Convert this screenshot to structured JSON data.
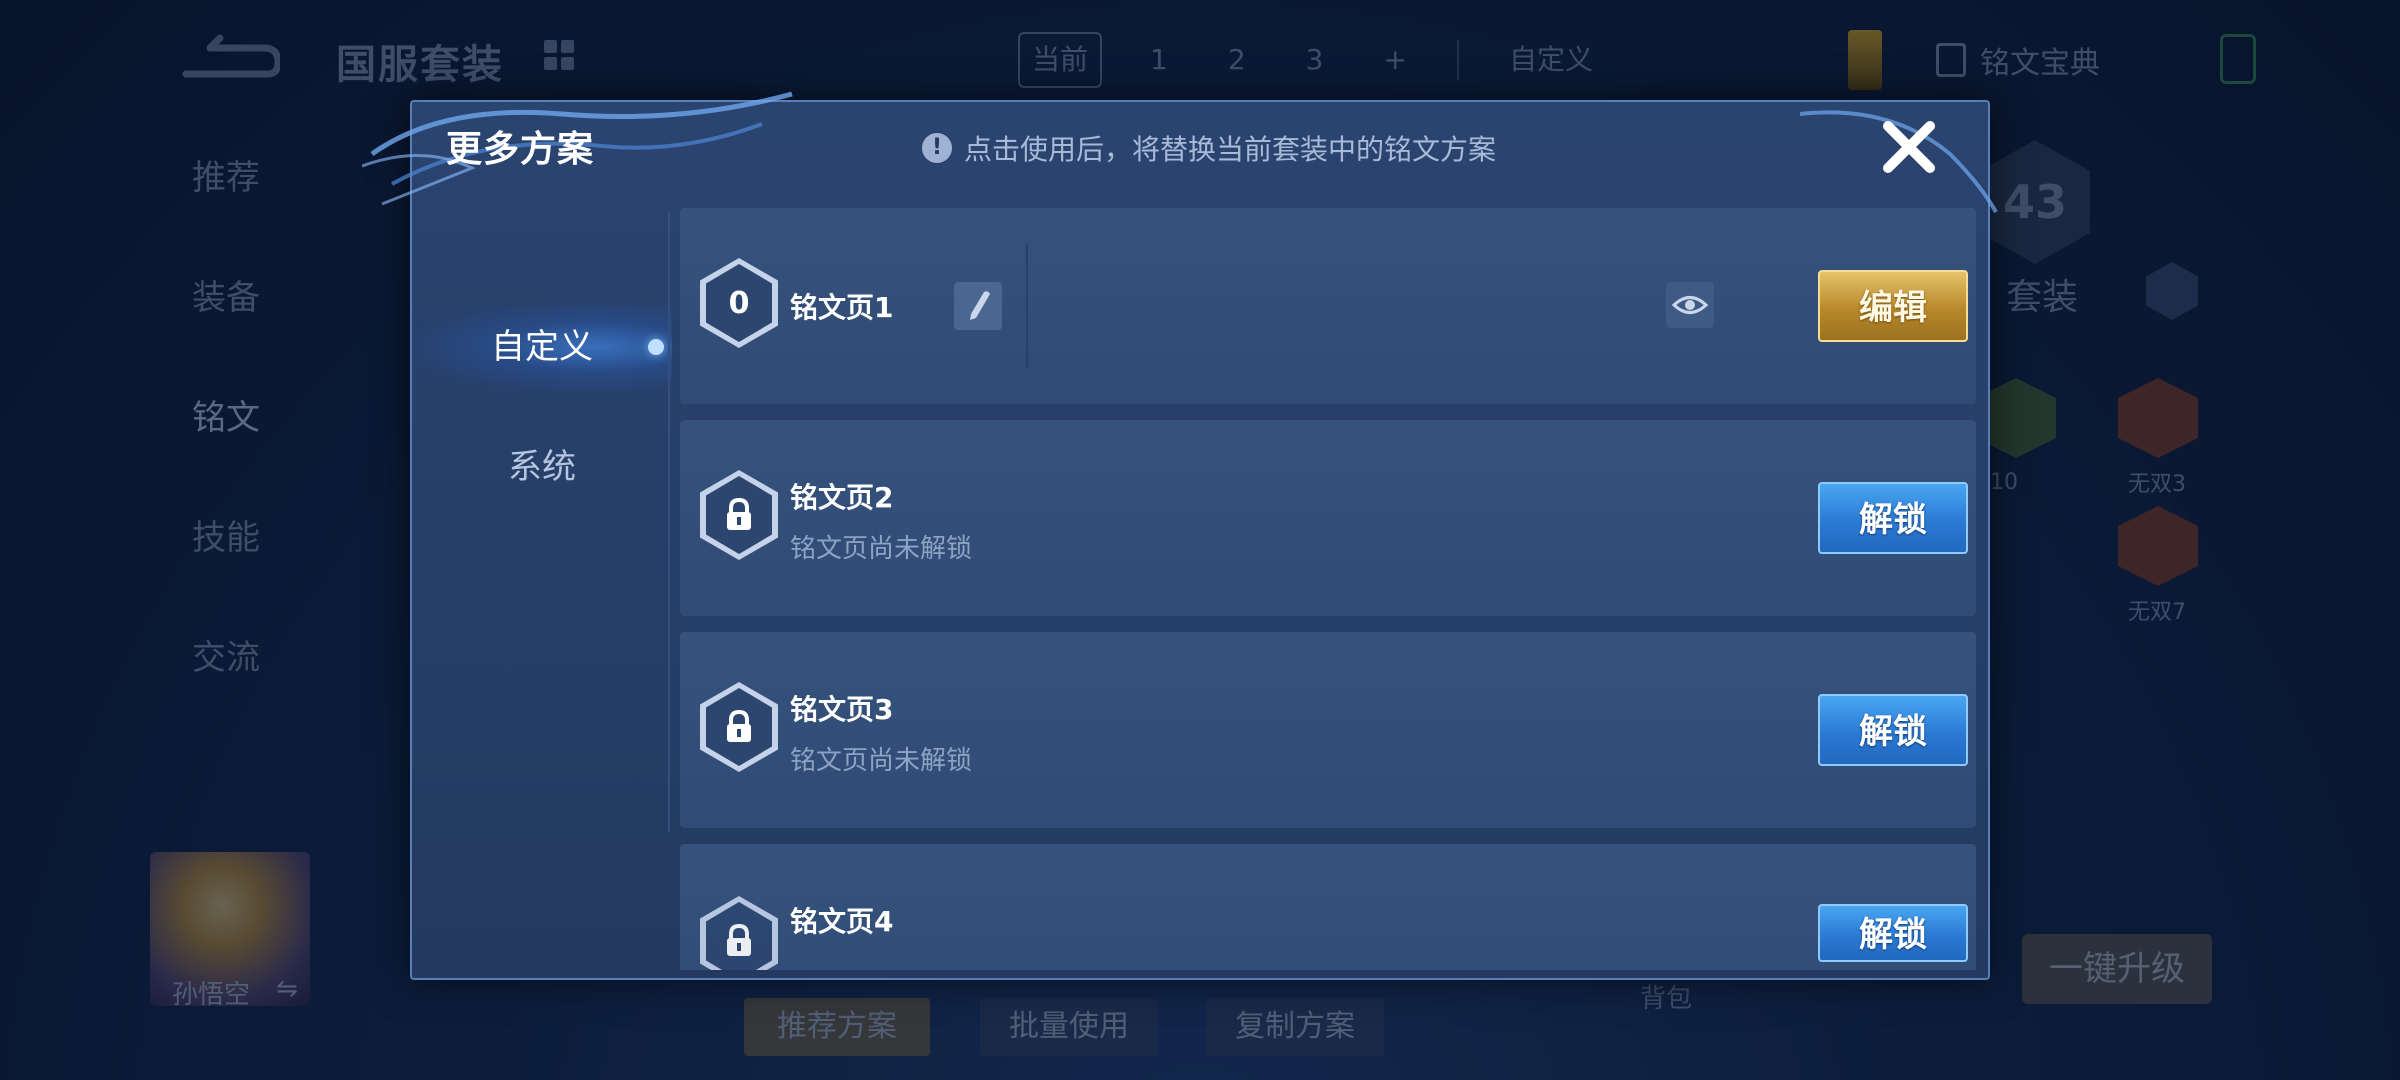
{
  "background": {
    "title": "国服套装",
    "page_tabs": [
      "当前",
      "1",
      "2",
      "3",
      "+"
    ],
    "custom_label": "自定义",
    "dict_label": "铭文宝典",
    "side_nav": [
      "推荐",
      "装备",
      "铭文",
      "技能",
      "交流"
    ],
    "hero_name": "孙悟空",
    "hero_swap": "⇋",
    "bottom_buttons": [
      "推荐方案",
      "批量使用",
      "复制方案"
    ],
    "bag_label": "背包",
    "upgrade_label": "一键升级",
    "level_number": "43",
    "set_label": "套装",
    "inscription_labels": [
      "无双3",
      "无双7",
      "10"
    ]
  },
  "modal": {
    "title": "更多方案",
    "notice_text": "点击使用后，将替换当前套装中的铭文方案",
    "notice_icon": "!",
    "tabs": {
      "active": "自定义",
      "inactive": "系统"
    },
    "rows": [
      {
        "badge": "0",
        "title": "铭文页1",
        "subtitle": "",
        "action": "编辑",
        "locked": false
      },
      {
        "badge": "",
        "title": "铭文页2",
        "subtitle": "铭文页尚未解锁",
        "action": "解锁",
        "locked": true
      },
      {
        "badge": "",
        "title": "铭文页3",
        "subtitle": "铭文页尚未解锁",
        "action": "解锁",
        "locked": true
      },
      {
        "badge": "",
        "title": "铭文页4",
        "subtitle": "",
        "action": "解锁",
        "locked": true
      }
    ]
  },
  "colors": {
    "accent_gold": "#d9b14f",
    "accent_blue": "#2f86e0",
    "modal_bg": "#2a4470"
  }
}
